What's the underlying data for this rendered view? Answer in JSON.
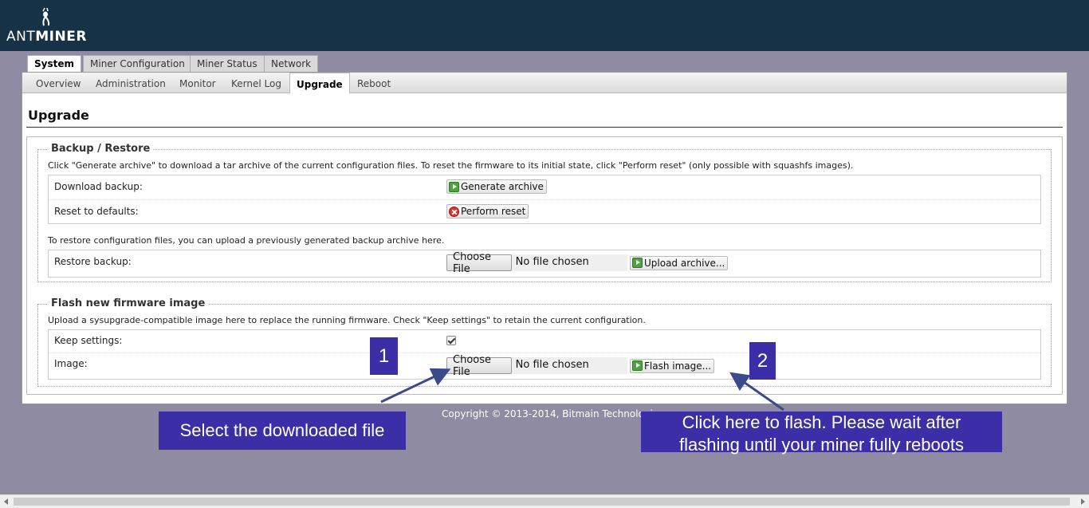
{
  "brand": {
    "logo_thin": "ANT",
    "logo_bold": "MINER"
  },
  "main_tabs": [
    {
      "label": "System",
      "active": true
    },
    {
      "label": "Miner Configuration",
      "active": false
    },
    {
      "label": "Miner Status",
      "active": false
    },
    {
      "label": "Network",
      "active": false
    }
  ],
  "sub_tabs": [
    {
      "label": "Overview",
      "active": false
    },
    {
      "label": "Administration",
      "active": false
    },
    {
      "label": "Monitor",
      "active": false
    },
    {
      "label": "Kernel Log",
      "active": false
    },
    {
      "label": "Upgrade",
      "active": true
    },
    {
      "label": "Reboot",
      "active": false
    }
  ],
  "page": {
    "title": "Upgrade"
  },
  "backup": {
    "legend": "Backup / Restore",
    "description": "Click \"Generate archive\" to download a tar archive of the current configuration files. To reset the firmware to its initial state, click \"Perform reset\" (only possible with squashfs images).",
    "download_label": "Download backup:",
    "generate_button": "Generate archive",
    "reset_label": "Reset to defaults:",
    "reset_button": "Perform reset",
    "restore_description": "To restore configuration files, you can upload a previously generated backup archive here.",
    "restore_label": "Restore backup:",
    "choose_file": "Choose File",
    "file_status": "No file chosen",
    "upload_button": "Upload archive..."
  },
  "flash": {
    "legend": "Flash new firmware image",
    "description": "Upload a sysupgrade-compatible image here to replace the running firmware. Check \"Keep settings\" to retain the current configuration.",
    "keep_label": "Keep settings:",
    "keep_checked": true,
    "image_label": "Image:",
    "choose_file": "Choose File",
    "file_status": "No file chosen",
    "flash_button": "Flash image..."
  },
  "footer": {
    "copyright": "Copyright © 2013-2014, Bitmain Technologies"
  },
  "annotations": {
    "badge_1": "1",
    "badge_2": "2",
    "callout_1": "Select the downloaded file",
    "callout_2_line1": "Click here to flash. Please wait after",
    "callout_2_line2": "flashing until your miner fully reboots",
    "color": "#3b2ea7"
  }
}
